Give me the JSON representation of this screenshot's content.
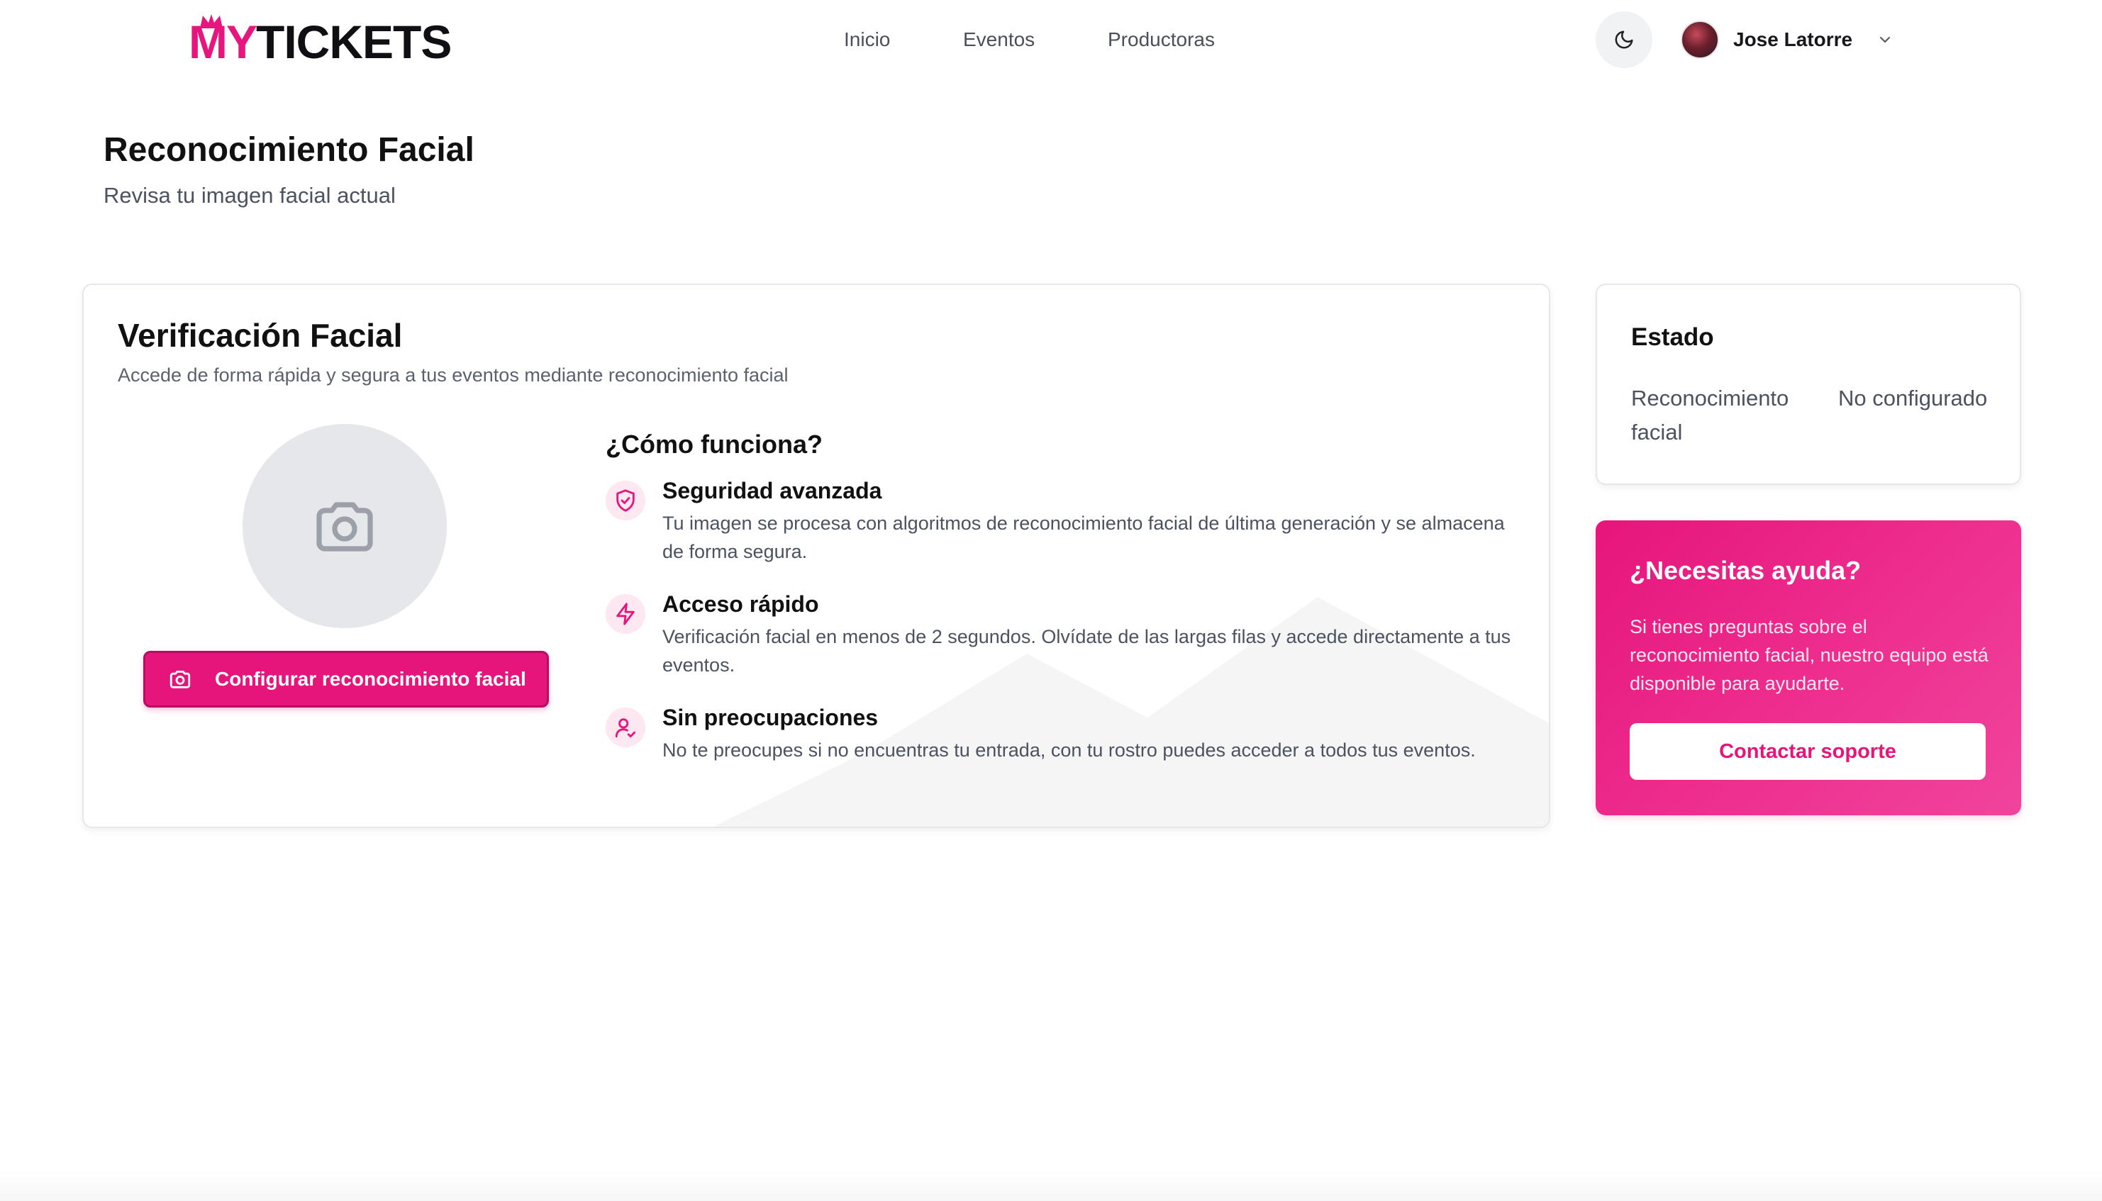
{
  "brand": {
    "logo_my": "MY",
    "logo_tickets": "TICKETS",
    "accent": "#e6157c"
  },
  "nav": {
    "items": [
      {
        "label": "Inicio"
      },
      {
        "label": "Eventos"
      },
      {
        "label": "Productoras"
      }
    ]
  },
  "header": {
    "theme_icon": "moon-icon",
    "user_name": "Jose Latorre"
  },
  "page": {
    "title": "Reconocimiento Facial",
    "subtitle": "Revisa tu imagen facial actual"
  },
  "verification": {
    "title": "Verificación Facial",
    "subtitle": "Accede de forma rápida y segura a tus eventos mediante reconocimiento facial",
    "configure_button": "Configurar reconocimiento facial",
    "how_title": "¿Cómo funciona?",
    "features": [
      {
        "icon": "shield-check-icon",
        "title": "Seguridad avanzada",
        "desc": "Tu imagen se procesa con algoritmos de reconocimiento facial de última generación y se almacena de forma segura."
      },
      {
        "icon": "lightning-icon",
        "title": "Acceso rápido",
        "desc": "Verificación facial en menos de 2 segundos. Olvídate de las largas filas y accede directamente a tus eventos."
      },
      {
        "icon": "user-check-icon",
        "title": "Sin preocupaciones",
        "desc": "No te preocupes si no encuentras tu entrada, con tu rostro puedes acceder a todos tus eventos."
      }
    ]
  },
  "state": {
    "title": "Estado",
    "label": "Reconocimiento facial",
    "value": "No configurado"
  },
  "help": {
    "title": "¿Necesitas ayuda?",
    "text": "Si tienes preguntas sobre el reconocimiento facial, nuestro equipo está disponible para ayudarte.",
    "button": "Contactar soporte"
  }
}
